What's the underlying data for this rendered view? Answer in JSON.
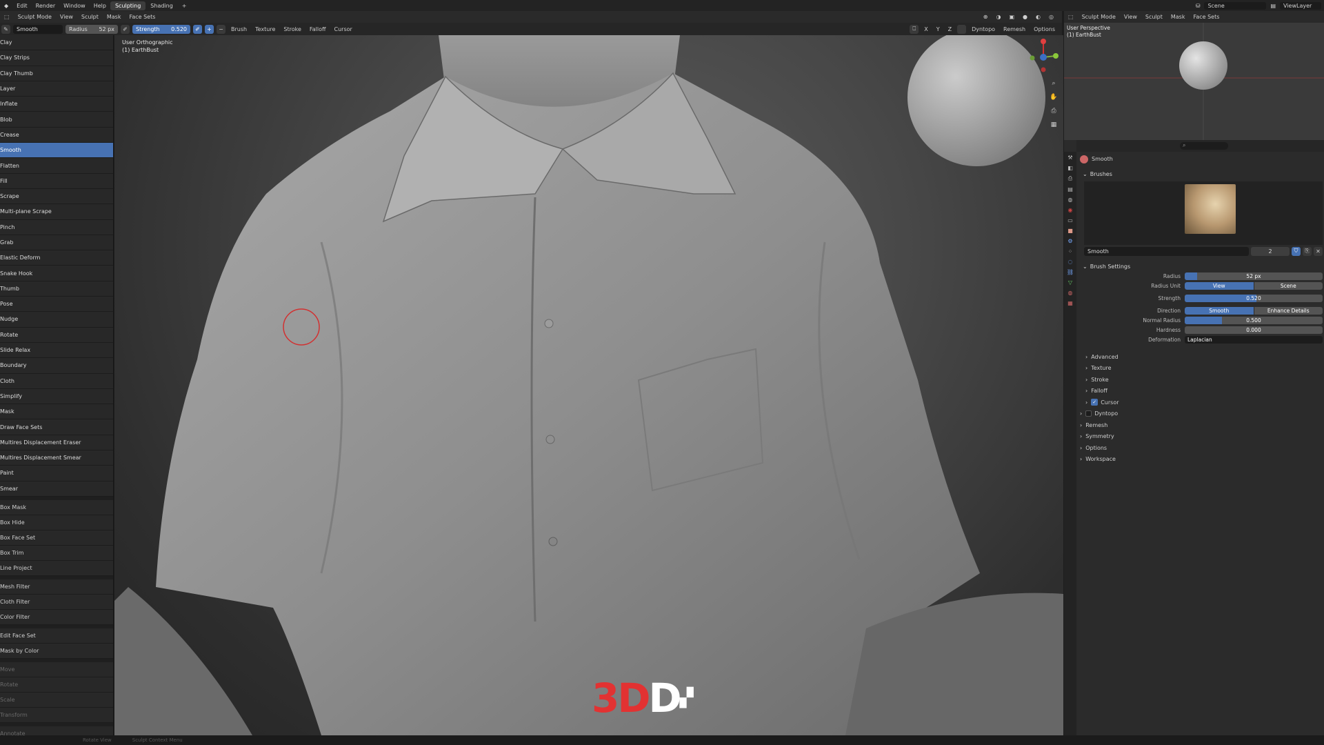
{
  "topbar": {
    "menus": [
      "Edit",
      "Render",
      "Window",
      "Help"
    ],
    "workspaces": [
      "Sculpting",
      "Shading"
    ],
    "add": "+",
    "scene": "Scene",
    "view_layer": "ViewLayer"
  },
  "header": {
    "mode": "Sculpt Mode",
    "menus": [
      "View",
      "Sculpt",
      "Mask",
      "Face Sets"
    ]
  },
  "toolsettings": {
    "brush_name": "Smooth",
    "radius_label": "Radius",
    "radius_value": "52 px",
    "strength_label": "Strength",
    "strength_value": "0.520",
    "dropdowns": [
      "Brush",
      "Texture",
      "Stroke",
      "Falloff",
      "Cursor"
    ],
    "axes": [
      "X",
      "Y",
      "Z"
    ],
    "dyntopo": "Dyntopo",
    "remesh": "Remesh",
    "options": "Options"
  },
  "brushes": [
    {
      "label": "Clay",
      "selected": false
    },
    {
      "label": "Clay Strips",
      "selected": false
    },
    {
      "label": "Clay Thumb",
      "selected": false
    },
    {
      "label": "Layer",
      "selected": false
    },
    {
      "label": "Inflate",
      "selected": false
    },
    {
      "label": "Blob",
      "selected": false
    },
    {
      "label": "Crease",
      "selected": false
    },
    {
      "label": "Smooth",
      "selected": true
    },
    {
      "label": "Flatten",
      "selected": false
    },
    {
      "label": "Fill",
      "selected": false
    },
    {
      "label": "Scrape",
      "selected": false
    },
    {
      "label": "Multi-plane Scrape",
      "selected": false
    },
    {
      "label": "Pinch",
      "selected": false
    },
    {
      "label": "Grab",
      "selected": false
    },
    {
      "label": "Elastic Deform",
      "selected": false
    },
    {
      "label": "Snake Hook",
      "selected": false
    },
    {
      "label": "Thumb",
      "selected": false
    },
    {
      "label": "Pose",
      "selected": false
    },
    {
      "label": "Nudge",
      "selected": false
    },
    {
      "label": "Rotate",
      "selected": false
    },
    {
      "label": "Slide Relax",
      "selected": false
    },
    {
      "label": "Boundary",
      "selected": false
    },
    {
      "label": "Cloth",
      "selected": false
    },
    {
      "label": "Simplify",
      "selected": false
    },
    {
      "label": "Mask",
      "selected": false
    },
    {
      "label": "Draw Face Sets",
      "selected": false
    },
    {
      "label": "Multires Displacement Eraser",
      "selected": false
    },
    {
      "label": "Multires Displacement Smear",
      "selected": false
    },
    {
      "label": "Paint",
      "selected": false
    },
    {
      "label": "Smear",
      "selected": false
    }
  ],
  "tool_groups": [
    {
      "items": [
        "Box Mask",
        "Box Hide",
        "Box Face Set",
        "Box Trim",
        "Line Project"
      ],
      "dim": false
    },
    {
      "items": [
        "Mesh Filter",
        "Cloth Filter",
        "Color Filter"
      ],
      "dim": false
    },
    {
      "items": [
        "Edit Face Set",
        "Mask by Color"
      ],
      "dim": false
    },
    {
      "items": [
        "Move",
        "Rotate",
        "Scale",
        "Transform"
      ],
      "dim": true
    },
    {
      "items": [
        "Annotate"
      ],
      "dim": true
    }
  ],
  "viewport": {
    "view_name": "User Orthographic",
    "object_name": "(1) EarthBust"
  },
  "logo": {
    "part1": "3D",
    "part2": "D"
  },
  "status": {
    "items": [
      "Rotate View",
      "Sculpt Context Menu"
    ]
  },
  "mini": {
    "mode": "Sculpt Mode",
    "menus": [
      "View",
      "Sculpt",
      "Mask",
      "Face Sets"
    ],
    "view_name": "User Perspective",
    "object_name": "(1) EarthBust"
  },
  "properties": {
    "active_brush": "Smooth",
    "brushes_section": "Brushes",
    "brush_field": "Smooth",
    "brush_users": "2",
    "brush_settings": "Brush Settings",
    "radius": {
      "label": "Radius",
      "value": "52 px",
      "fraction": 0.09
    },
    "radius_unit": {
      "label": "Radius Unit",
      "options": [
        "View",
        "Scene"
      ]
    },
    "strength": {
      "label": "Strength",
      "value": "0.520",
      "fraction": 0.52
    },
    "direction": {
      "label": "Direction",
      "options": [
        "Smooth",
        "Enhance Details"
      ]
    },
    "normal_radius": {
      "label": "Normal Radius",
      "value": "0.500",
      "fraction": 0.27
    },
    "hardness": {
      "label": "Hardness",
      "value": "0.000",
      "fraction": 0.0
    },
    "deformation": {
      "label": "Deformation",
      "value": "Laplacian"
    },
    "subpanels": [
      "Advanced",
      "Texture",
      "Stroke",
      "Falloff",
      "Cursor"
    ],
    "panels": [
      "Dyntopo",
      "Remesh",
      "Symmetry",
      "Options",
      "Workspace"
    ]
  },
  "colors": {
    "accent": "#4772b3",
    "logo_red": "#e23232",
    "cursor_ring": "#d23030"
  }
}
